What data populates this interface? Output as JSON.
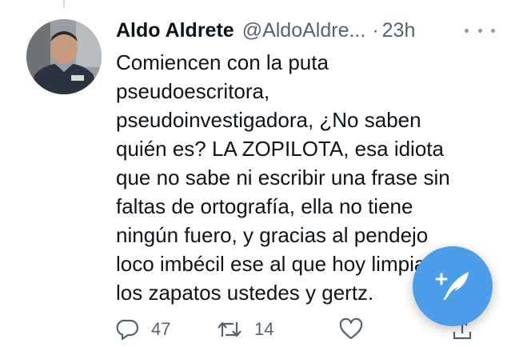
{
  "tweet": {
    "display_name": "Aldo Aldrete",
    "handle": "@AldoAldre...",
    "separator": "·",
    "timestamp": "23h",
    "text": "Comiencen con la puta\npseudoescritora,\npseudoinvestigadora, ¿No saben\nquién es? LA ZOPILOTA,  esa idiota\nque no sabe ni escribir una frase sin\nfaltas de ortografía, ella no tiene\nningún fuero, y gracias al pendejo\nloco imbécil ese al que hoy limpian\nlos zapatos ustedes y gertz.",
    "reply_count": "47",
    "retweet_count": "14"
  },
  "icons": {
    "more": "more-horizontal-icon",
    "reply": "reply-icon",
    "retweet": "retweet-icon",
    "like": "heart-icon",
    "share": "share-icon",
    "compose": "compose-feather-icon"
  },
  "colors": {
    "text": "#0f1419",
    "secondary_text": "#536471",
    "fab_background": "#4c9de8",
    "action_icon": "#536471"
  }
}
